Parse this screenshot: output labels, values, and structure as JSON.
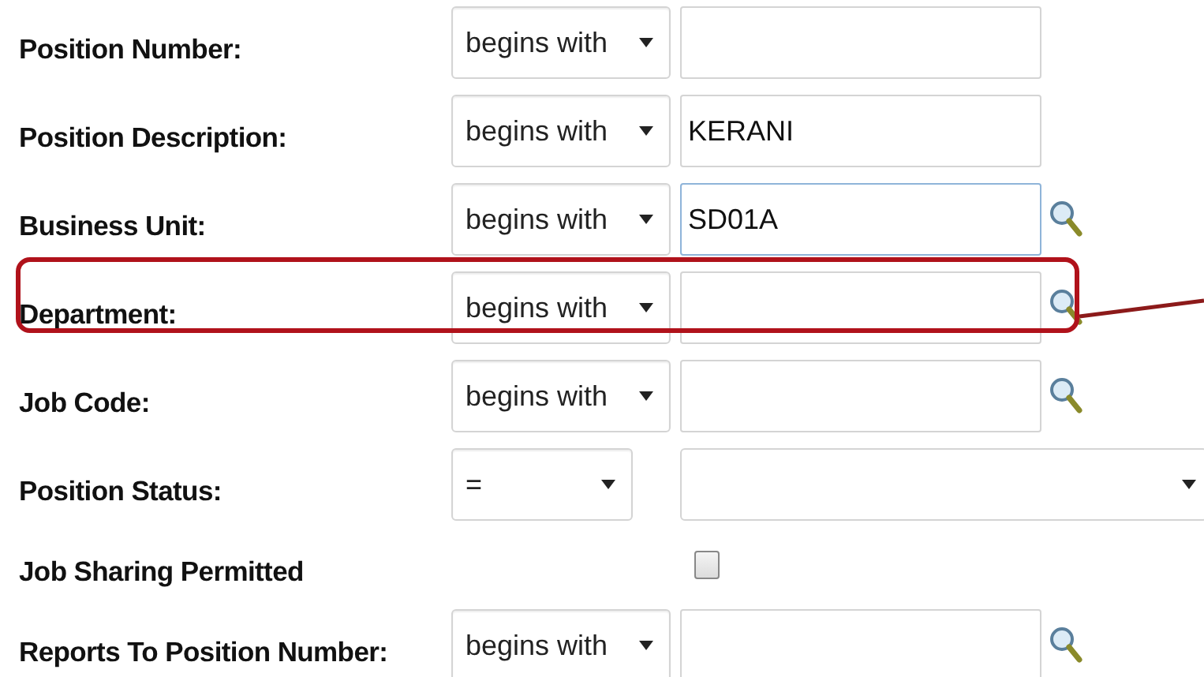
{
  "fields": [
    {
      "kind": "text",
      "label": "Position Number:",
      "operator": "begins with",
      "lookup": false,
      "focused": false,
      "highlighted": false
    },
    {
      "kind": "text",
      "label": "Position Description:",
      "operator": "begins with",
      "value": "KERANI",
      "lookup": false,
      "focused": false,
      "highlighted": false
    },
    {
      "kind": "text",
      "label": "Business Unit:",
      "operator": "begins with",
      "value": "SD01A",
      "lookup": true,
      "focused": true,
      "highlighted": false
    },
    {
      "kind": "text",
      "label": "Department:",
      "operator": "begins with",
      "lookup": true,
      "focused": false,
      "highlighted": true
    },
    {
      "kind": "text",
      "label": "Job Code:",
      "operator": "begins with",
      "lookup": true,
      "focused": false,
      "highlighted": false
    },
    {
      "kind": "select",
      "label": "Position Status:",
      "operator": "=",
      "highlighted": false
    },
    {
      "kind": "checkbox",
      "label": "Job Sharing Permitted",
      "checked": false,
      "highlighted": false
    },
    {
      "kind": "text",
      "label": "Reports To Position Number:",
      "operator": "begins with",
      "lookup": true,
      "focused": false,
      "highlighted": false
    }
  ]
}
